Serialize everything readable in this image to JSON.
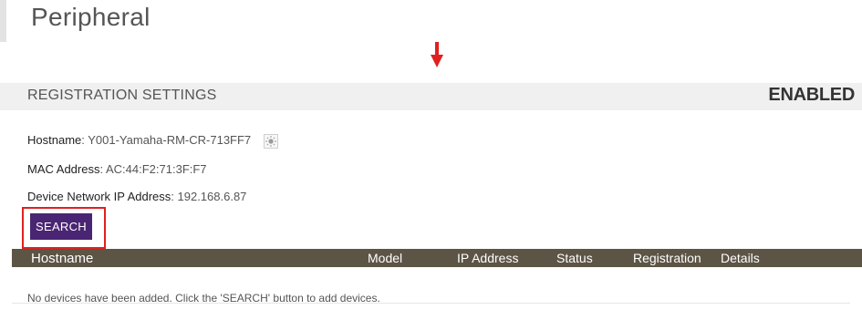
{
  "page": {
    "title": "Peripheral"
  },
  "section": {
    "title": "REGISTRATION SETTINGS",
    "status": "ENABLED"
  },
  "device": {
    "hostname_label": "Hostname",
    "hostname_value": ": Y001-Yamaha-RM-CR-713FF7",
    "mac_label": "MAC Address",
    "mac_value": ": AC:44:F2:71:3F:F7",
    "ip_label": "Device Network IP Address",
    "ip_value": ": 192.168.6.87"
  },
  "search_button": {
    "label": "SEARCH"
  },
  "table": {
    "columns": [
      "Hostname",
      "Model",
      "IP Address",
      "Status",
      "Registration",
      "Details"
    ],
    "empty_message": "No devices have been added. Click the 'SEARCH' button to add devices."
  },
  "colors": {
    "accent": "#4a2573",
    "highlight": "#e02020",
    "table_header": "#5c5445"
  },
  "icons": {
    "identify": "sun-icon",
    "pointer": "arrow-down-icon"
  }
}
